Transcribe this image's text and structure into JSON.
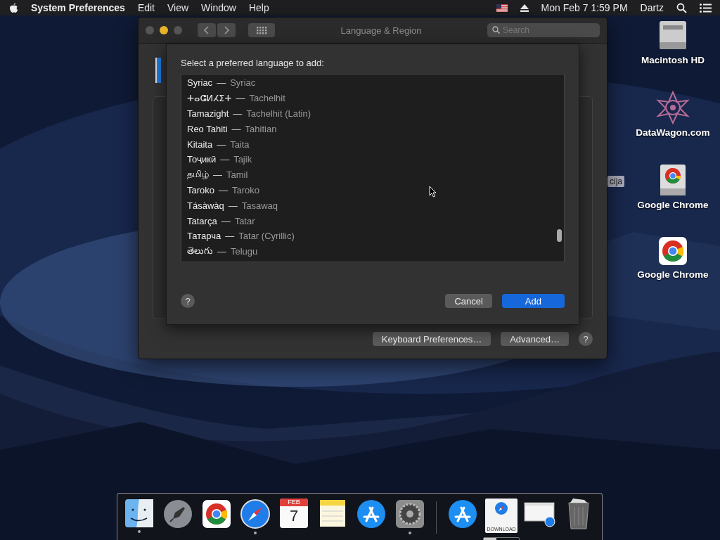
{
  "menu_bar": {
    "app_name": "System Preferences",
    "menus": [
      "Edit",
      "View",
      "Window",
      "Help"
    ],
    "clock": "Mon Feb 7  1:59 PM",
    "user": "Dartz"
  },
  "window": {
    "title": "Language & Region",
    "search": {
      "placeholder": "Search"
    },
    "buttons": [
      "Keyboard Preferences…",
      "Advanced…"
    ],
    "help": "?"
  },
  "sheet": {
    "prompt": "Select a preferred language to add:",
    "languages": [
      {
        "native": "Syriac",
        "dash": "—",
        "english": "Syriac"
      },
      {
        "native": "ⵜⴰⵛⵍⵃⵉⵜ",
        "dash": "—",
        "english": "Tachelhit"
      },
      {
        "native": "Tamazight",
        "dash": "—",
        "english": "Tachelhit (Latin)"
      },
      {
        "native": "Reo Tahiti",
        "dash": "—",
        "english": "Tahitian"
      },
      {
        "native": "Kitaita",
        "dash": "—",
        "english": "Taita"
      },
      {
        "native": "Тоҷикӣ",
        "dash": "—",
        "english": "Tajik"
      },
      {
        "native": "தமிழ்",
        "dash": "—",
        "english": "Tamil"
      },
      {
        "native": "Taroko",
        "dash": "—",
        "english": "Taroko"
      },
      {
        "native": "Tásàwàq",
        "dash": "—",
        "english": "Tasawaq"
      },
      {
        "native": "Tatarça",
        "dash": "—",
        "english": "Tatar"
      },
      {
        "native": "Татарча",
        "dash": "—",
        "english": "Tatar (Cyrillic)"
      },
      {
        "native": "తెలుగు",
        "dash": "—",
        "english": "Telugu"
      }
    ],
    "buttons": [
      {
        "label": "Cancel",
        "default": false
      },
      {
        "label": "Add",
        "default": true
      }
    ],
    "help": "?"
  },
  "desktop_icons": [
    {
      "label": "Macintosh HD",
      "kind": "drive"
    },
    {
      "label": "DataWagon.com",
      "kind": "star"
    },
    {
      "label": "Google Chrome",
      "kind": "chrome-drive"
    },
    {
      "label": "Google Chrome",
      "kind": "chrome"
    }
  ],
  "hidden_label": "cija",
  "dock": {
    "items": [
      {
        "kind": "finder",
        "running": true
      },
      {
        "kind": "launchpad",
        "running": false
      },
      {
        "kind": "chrome",
        "running": false
      },
      {
        "kind": "safari",
        "running": true
      },
      {
        "kind": "calendar",
        "running": false,
        "month": "FEB",
        "day": "7"
      },
      {
        "kind": "notes",
        "running": false
      },
      {
        "kind": "appstore",
        "running": false
      },
      {
        "kind": "settings",
        "running": true
      },
      {
        "kind": "separator"
      },
      {
        "kind": "appstore",
        "running": false
      },
      {
        "kind": "download",
        "running": false,
        "caption": "DOWNLOAD",
        "level": 0.35
      },
      {
        "kind": "screenshot",
        "running": false
      },
      {
        "kind": "trash",
        "running": false
      }
    ]
  }
}
